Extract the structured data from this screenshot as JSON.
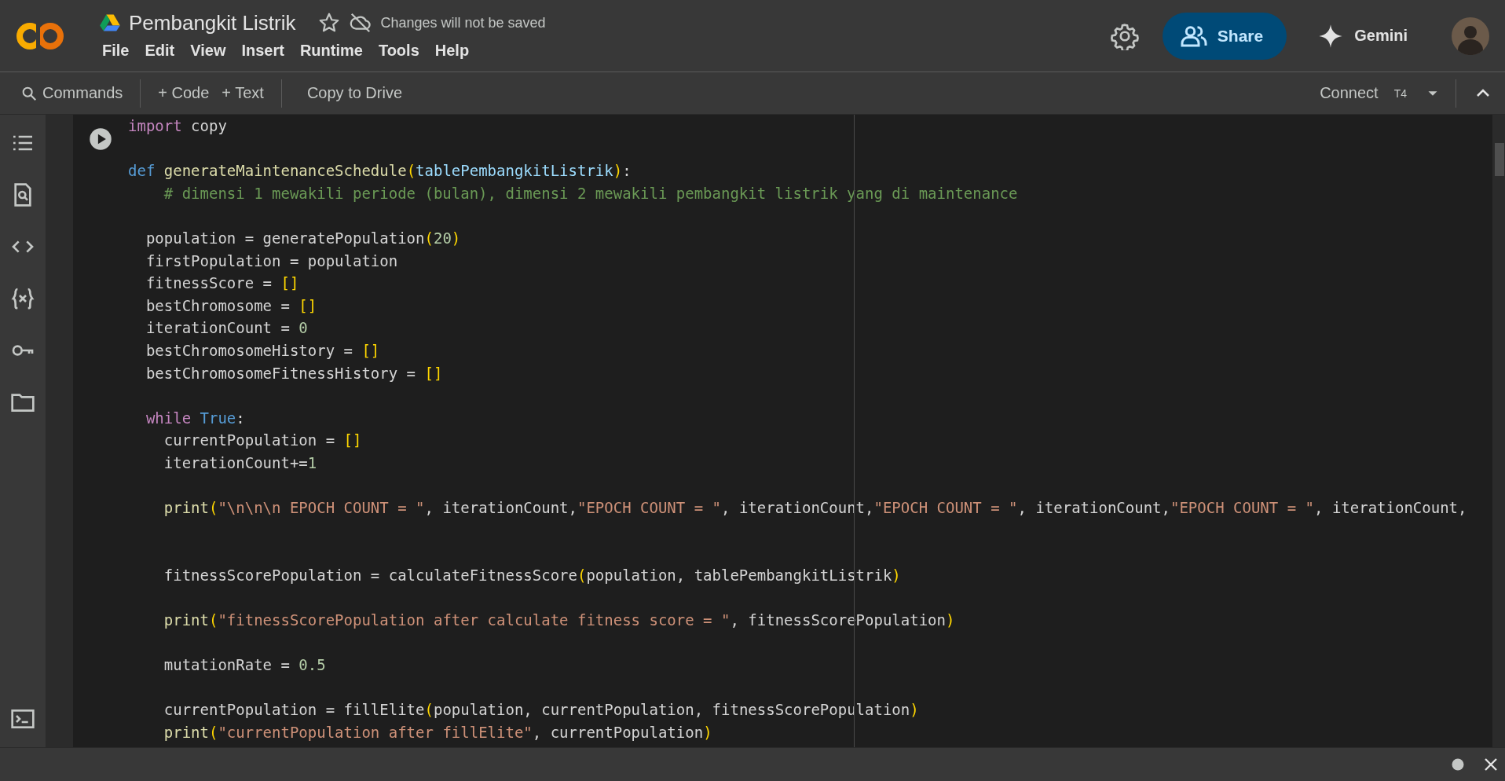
{
  "header": {
    "title": "Pembangkit Listrik",
    "save_status": "Changes will not be saved",
    "menu": [
      "File",
      "Edit",
      "View",
      "Insert",
      "Runtime",
      "Tools",
      "Help"
    ],
    "share_button": "Share",
    "gemini_button": "Gemini"
  },
  "toolbar": {
    "commands": "Commands",
    "add_code": "+ Code",
    "add_text": "+ Text",
    "copy_to_drive": "Copy to Drive",
    "connect": "Connect",
    "runtime_type": "T4"
  },
  "code_cell": {
    "lines": [
      {
        "kind": "code",
        "tokens": [
          {
            "kind": "keyword",
            "text": "import"
          },
          {
            "kind": "plain",
            "text": " copy"
          }
        ]
      },
      {
        "kind": "blank"
      },
      {
        "kind": "code",
        "tokens": [
          {
            "kind": "storage",
            "text": "def"
          },
          {
            "kind": "function",
            "text": " generateMaintenanceSchedule"
          },
          {
            "kind": "bracket",
            "text": "("
          },
          {
            "kind": "param",
            "text": "tablePembangkitListrik"
          },
          {
            "kind": "bracket",
            "text": ")"
          },
          {
            "kind": "plain",
            "text": ":"
          }
        ]
      },
      {
        "kind": "code",
        "tokens": [
          {
            "kind": "comment",
            "text": "    # dimensi 1 mewakili periode (bulan), dimensi 2 mewakili pembangkit listrik yang di maintenance"
          }
        ]
      },
      {
        "kind": "blank"
      },
      {
        "kind": "code",
        "tokens": [
          {
            "kind": "plain",
            "text": "  population = generatePopulation"
          },
          {
            "kind": "bracket",
            "text": "("
          },
          {
            "kind": "number",
            "text": "20"
          },
          {
            "kind": "bracket",
            "text": ")"
          }
        ]
      },
      {
        "kind": "code",
        "tokens": [
          {
            "kind": "plain",
            "text": "  firstPopulation = population"
          }
        ]
      },
      {
        "kind": "code",
        "tokens": [
          {
            "kind": "plain",
            "text": "  fitnessScore = "
          },
          {
            "kind": "bracket",
            "text": "[]"
          }
        ]
      },
      {
        "kind": "code",
        "tokens": [
          {
            "kind": "plain",
            "text": "  bestChromosome = "
          },
          {
            "kind": "bracket",
            "text": "[]"
          }
        ]
      },
      {
        "kind": "code",
        "tokens": [
          {
            "kind": "plain",
            "text": "  iterationCount = "
          },
          {
            "kind": "number",
            "text": "0"
          }
        ]
      },
      {
        "kind": "code",
        "tokens": [
          {
            "kind": "plain",
            "text": "  bestChromosomeHistory = "
          },
          {
            "kind": "bracket",
            "text": "[]"
          }
        ]
      },
      {
        "kind": "code",
        "tokens": [
          {
            "kind": "plain",
            "text": "  bestChromosomeFitnessHistory = "
          },
          {
            "kind": "bracket",
            "text": "[]"
          }
        ]
      },
      {
        "kind": "blank"
      },
      {
        "kind": "code",
        "tokens": [
          {
            "kind": "keyword",
            "text": "  while"
          },
          {
            "kind": "storage",
            "text": " True"
          },
          {
            "kind": "plain",
            "text": ":"
          }
        ]
      },
      {
        "kind": "code",
        "tokens": [
          {
            "kind": "plain",
            "text": "    currentPopulation = "
          },
          {
            "kind": "bracket",
            "text": "[]"
          }
        ]
      },
      {
        "kind": "code",
        "tokens": [
          {
            "kind": "plain",
            "text": "    iterationCount+="
          },
          {
            "kind": "number",
            "text": "1"
          }
        ]
      },
      {
        "kind": "blank"
      },
      {
        "kind": "code",
        "tokens": [
          {
            "kind": "function",
            "text": "    print"
          },
          {
            "kind": "bracket",
            "text": "("
          },
          {
            "kind": "string",
            "text": "\"\\n\\n\\n EPOCH COUNT = \""
          },
          {
            "kind": "plain",
            "text": ", iterationCount,"
          },
          {
            "kind": "string",
            "text": "\"EPOCH COUNT = \""
          },
          {
            "kind": "plain",
            "text": ", iterationCount,"
          },
          {
            "kind": "string",
            "text": "\"EPOCH COUNT = \""
          },
          {
            "kind": "plain",
            "text": ", iterationCount,"
          },
          {
            "kind": "string",
            "text": "\"EPOCH COUNT = \""
          },
          {
            "kind": "plain",
            "text": ", iterationCount,"
          }
        ]
      },
      {
        "kind": "blank"
      },
      {
        "kind": "blank"
      },
      {
        "kind": "code",
        "tokens": [
          {
            "kind": "plain",
            "text": "    fitnessScorePopulation = calculateFitnessScore"
          },
          {
            "kind": "bracket",
            "text": "("
          },
          {
            "kind": "plain",
            "text": "population, tablePembangkitListrik"
          },
          {
            "kind": "bracket",
            "text": ")"
          }
        ]
      },
      {
        "kind": "blank"
      },
      {
        "kind": "code",
        "tokens": [
          {
            "kind": "function",
            "text": "    print"
          },
          {
            "kind": "bracket",
            "text": "("
          },
          {
            "kind": "string",
            "text": "\"fitnessScorePopulation after calculate fitness score = \""
          },
          {
            "kind": "plain",
            "text": ", fitnessScorePopulation"
          },
          {
            "kind": "bracket",
            "text": ")"
          }
        ]
      },
      {
        "kind": "blank"
      },
      {
        "kind": "code",
        "tokens": [
          {
            "kind": "plain",
            "text": "    mutationRate = "
          },
          {
            "kind": "number",
            "text": "0.5"
          }
        ]
      },
      {
        "kind": "blank"
      },
      {
        "kind": "code",
        "tokens": [
          {
            "kind": "plain",
            "text": "    currentPopulation = fillElite"
          },
          {
            "kind": "bracket",
            "text": "("
          },
          {
            "kind": "plain",
            "text": "population, currentPopulation, fitnessScorePopulation"
          },
          {
            "kind": "bracket",
            "text": ")"
          }
        ]
      },
      {
        "kind": "code",
        "tokens": [
          {
            "kind": "function",
            "text": "    print"
          },
          {
            "kind": "bracket",
            "text": "("
          },
          {
            "kind": "string",
            "text": "\"currentPopulation after fillElite\""
          },
          {
            "kind": "plain",
            "text": ", currentPopulation"
          },
          {
            "kind": "bracket",
            "text": ")"
          }
        ]
      }
    ]
  }
}
